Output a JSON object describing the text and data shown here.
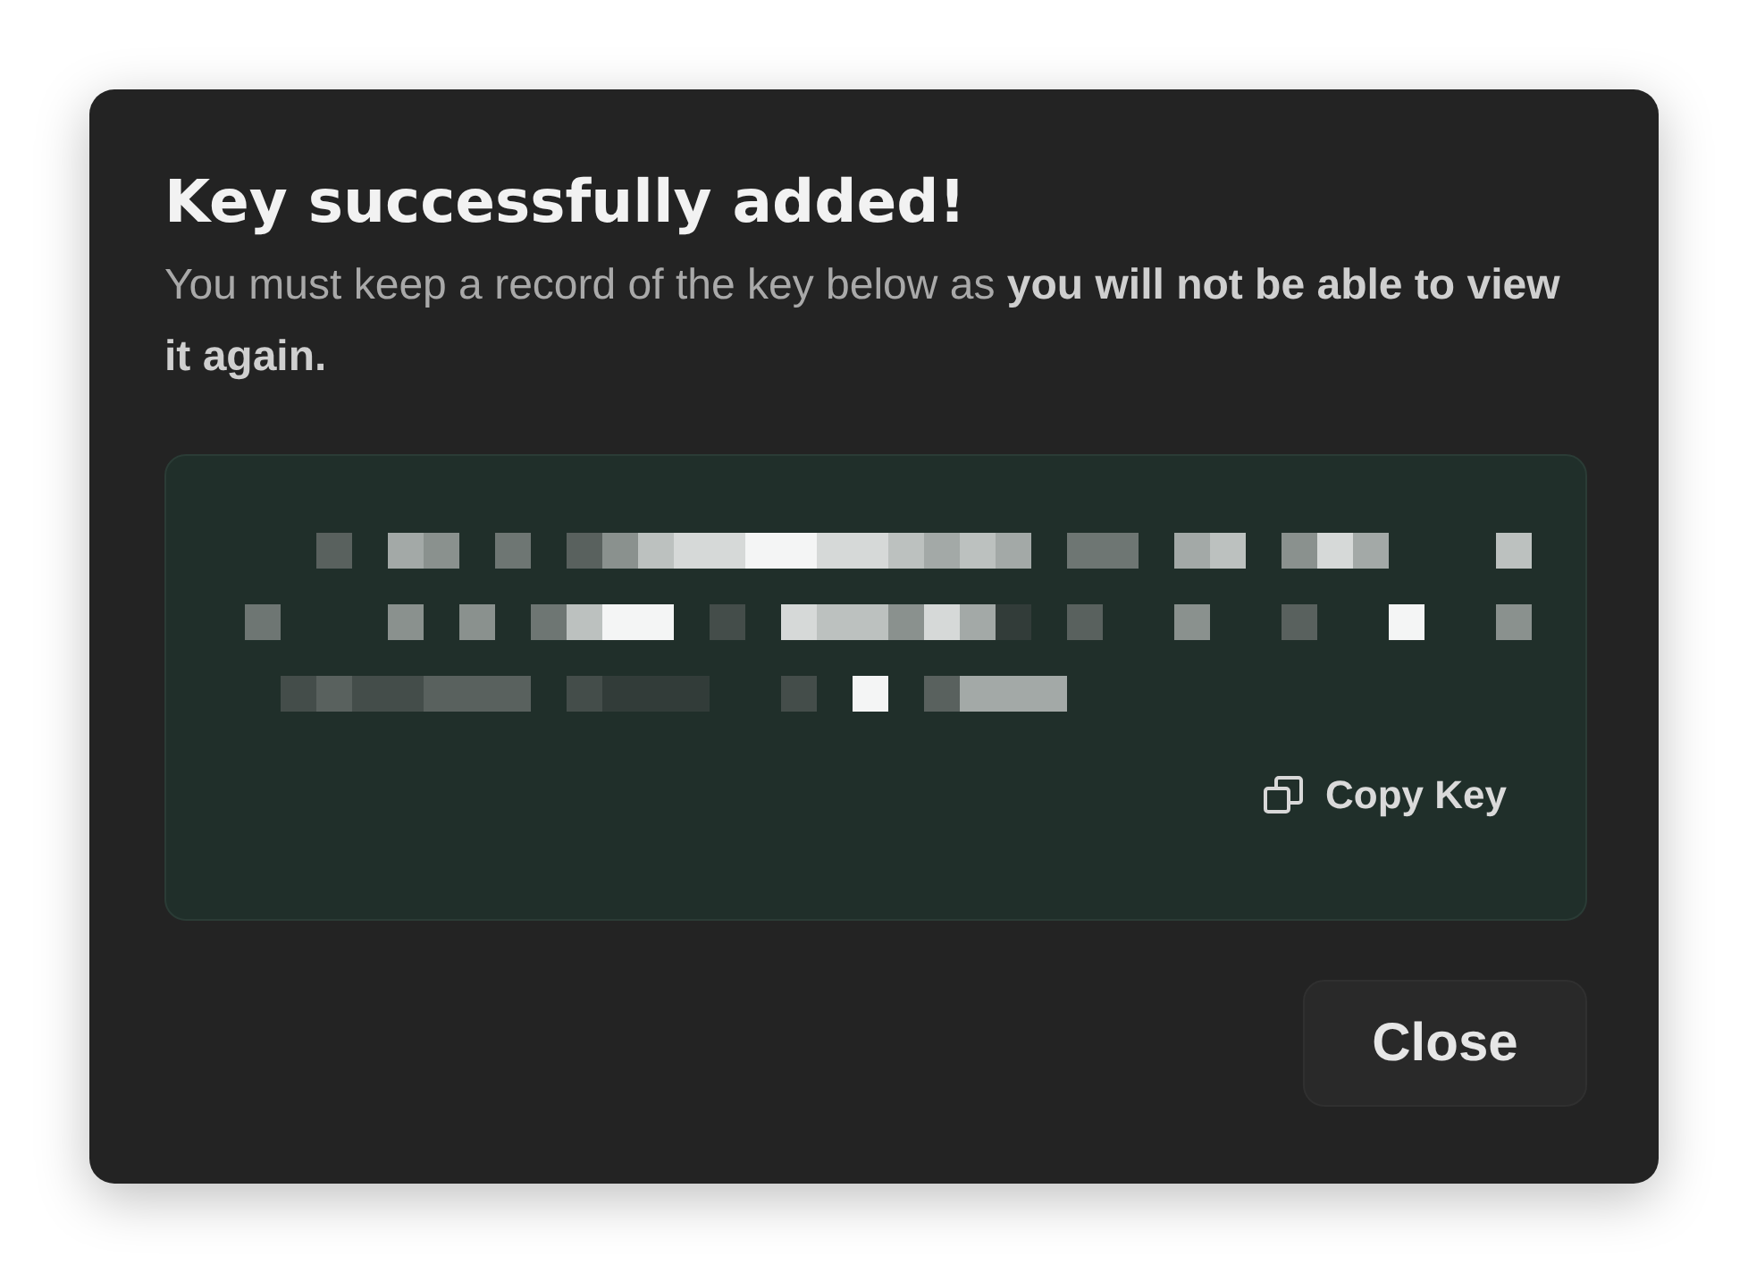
{
  "dialog": {
    "title": "Key successfully added!",
    "message": "You must keep a record of the key below as **you will not be able to view it again.**",
    "copy_button": "Copy Key",
    "close_button": "Close"
  }
}
